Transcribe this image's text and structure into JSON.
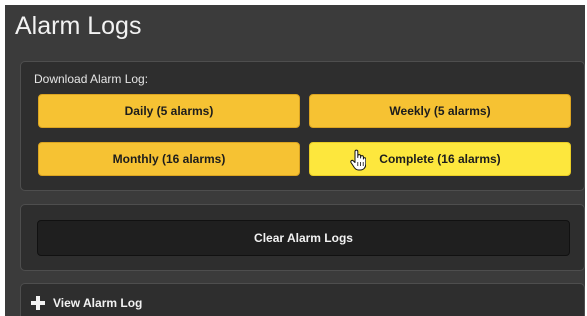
{
  "page": {
    "title": "Alarm Logs"
  },
  "download": {
    "label": "Download Alarm Log:",
    "buttons": {
      "daily": "Daily (5 alarms)",
      "weekly": "Weekly (5 alarms)",
      "monthly": "Monthly (16 alarms)",
      "complete": "Complete (16 alarms)"
    },
    "hovered": "complete"
  },
  "clear": {
    "button_label": "Clear Alarm Logs"
  },
  "view": {
    "toggle_label": "View Alarm Log",
    "icon": "plus-icon"
  },
  "colors": {
    "background": "#3b3b3b",
    "card": "#2e2e2e",
    "button_yellow": "#f6c233",
    "button_yellow_hover": "#fde73d",
    "dark_button": "#1f1f1f"
  }
}
